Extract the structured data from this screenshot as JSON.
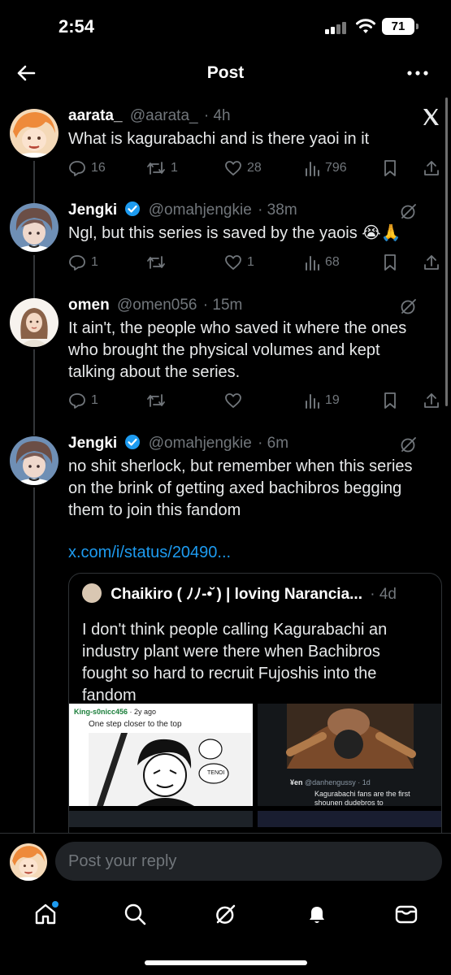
{
  "status_bar": {
    "time": "2:54",
    "battery": "71"
  },
  "header": {
    "title": "Post"
  },
  "tweets": [
    {
      "display_name": "aarata_",
      "handle": "@aarata_",
      "time": "· 4h",
      "text": "What is kagurabachi and is there yaoi in it",
      "replies": "16",
      "reposts": "1",
      "likes": "28",
      "views": "796"
    },
    {
      "display_name": "Jengki",
      "handle": "@omahjengkie",
      "time": "· 38m",
      "text": "Ngl, but this series is saved by the yaois 😭🙏",
      "replies": "1",
      "reposts": "",
      "likes": "1",
      "views": "68"
    },
    {
      "display_name": "omen",
      "handle": "@omen056",
      "time": "· 15m",
      "text": "It ain't, the people who saved it where the ones who brought the physical volumes and kept talking about the series.",
      "replies": "1",
      "reposts": "",
      "likes": "",
      "views": "19"
    },
    {
      "display_name": "Jengki",
      "handle": "@omahjengkie",
      "time": "· 6m",
      "text": "no shit sherlock, but remember when this series on the brink of getting axed bachibros begging them to join this fandom",
      "link": "x.com/i/status/20490...",
      "quote": {
        "display_name": "Chaikiro ( ﾉﾉ-•̆ ) | loving Narancia...",
        "time": "· 4d",
        "text": "I don't think people calling Kagurabachi an industry plant were there when Bachibros fought so hard to recruit Fujoshis into the fandom",
        "media": {
          "meme_user": "King-s0nicc456",
          "meme_time": "· 2y ago",
          "meme_caption": "One step closer to the top",
          "meme_bubble": "TENOI",
          "dark_user": "¥en",
          "dark_handle": "@danhengussy · 1d",
          "dark_caption": "Kagurabachi fans are the first shounen dudebros to"
        }
      }
    }
  ],
  "reply_bar": {
    "placeholder": "Post your reply"
  },
  "colors": {
    "accent": "#1d9bf0",
    "muted": "#71767b",
    "background": "#000000"
  }
}
